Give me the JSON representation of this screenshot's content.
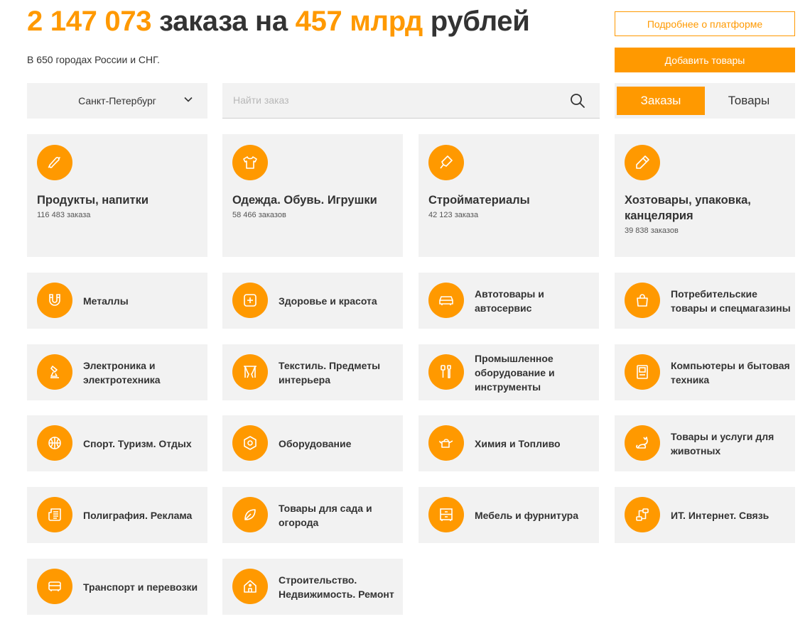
{
  "header": {
    "count": "2 147 073",
    "mid": " заказа на ",
    "amount": "457 млрд",
    "tail": " рублей",
    "subtitle": "В 650 городах России и СНГ."
  },
  "actions": {
    "about": "Подробнее о платформе",
    "add": "Добавить товары"
  },
  "city": {
    "value": "Санкт-Петербург"
  },
  "search": {
    "placeholder": "Найти заказ"
  },
  "tabs": [
    {
      "label": "Заказы",
      "active": true
    },
    {
      "label": "Товары",
      "active": false
    }
  ],
  "featured": [
    {
      "title": "Продукты, напитки",
      "count": "116 483 заказа",
      "icon": "sausage-icon"
    },
    {
      "title": "Одежда. Обувь. Игрушки",
      "count": "58 466 заказов",
      "icon": "tshirt-icon"
    },
    {
      "title": "Стройматериалы",
      "count": "42 123 заказа",
      "icon": "trowel-icon"
    },
    {
      "title": "Хозтовары, упаковка, канцелярия",
      "count": "39 838 заказов",
      "icon": "pencil-icon"
    }
  ],
  "categories": [
    {
      "title": "Металлы",
      "icon": "magnet-icon"
    },
    {
      "title": "Здоровье и красота",
      "icon": "first-aid-icon"
    },
    {
      "title": "Автотовары и автосервис",
      "icon": "car-icon"
    },
    {
      "title": "Потребительские товары и спецмагазины",
      "icon": "shopping-bag-icon"
    },
    {
      "title": "Электроника и электротехника",
      "icon": "lamp-icon"
    },
    {
      "title": "Текстиль. Предметы интерьера",
      "icon": "curtains-icon"
    },
    {
      "title": "Промышленное оборудование и инструменты",
      "icon": "tools-icon"
    },
    {
      "title": "Компьютеры и бытовая техника",
      "icon": "appliance-icon"
    },
    {
      "title": "Спорт. Туризм. Отдых",
      "icon": "ball-icon"
    },
    {
      "title": "Оборудование",
      "icon": "nut-icon"
    },
    {
      "title": "Химия и Топливо",
      "icon": "watering-can-icon"
    },
    {
      "title": "Товары и услуги для животных",
      "icon": "cat-icon"
    },
    {
      "title": "Полиграфия. Реклама",
      "icon": "newspaper-icon"
    },
    {
      "title": "Товары для сада и огорода",
      "icon": "leaf-icon"
    },
    {
      "title": "Мебель и фурнитура",
      "icon": "dresser-icon"
    },
    {
      "title": "ИТ. Интернет. Связь",
      "icon": "network-icon"
    },
    {
      "title": "Транспорт и перевозки",
      "icon": "bus-icon"
    },
    {
      "title": "Строительство. Недвижимость. Ремонт",
      "icon": "house-icon"
    }
  ],
  "colors": {
    "accent": "#ff9900",
    "card_bg": "#f2f2f2",
    "text": "#333333"
  }
}
